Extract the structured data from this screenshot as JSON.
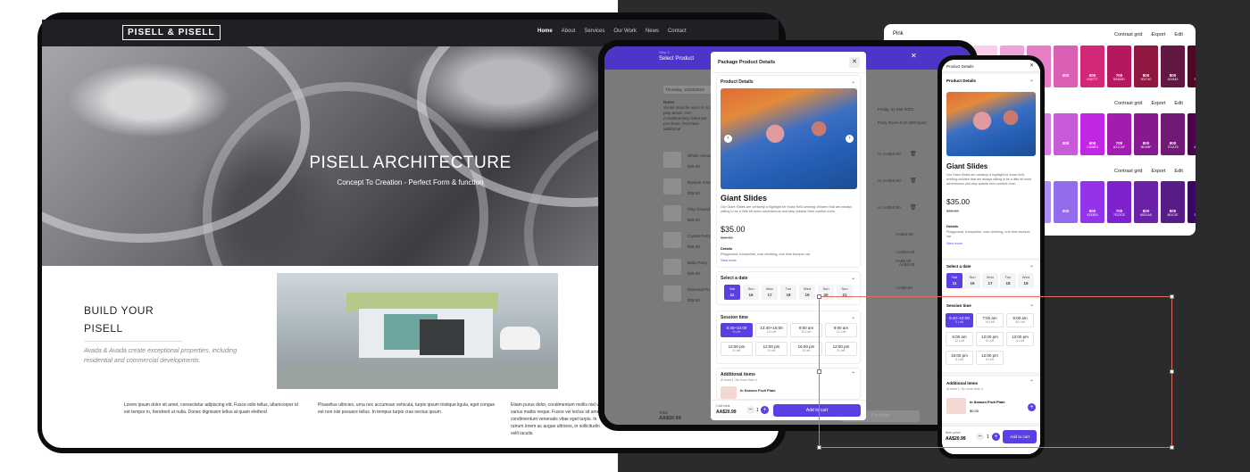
{
  "site": {
    "logo": "PISELL & PISELL",
    "nav": [
      "Home",
      "About",
      "Services",
      "Our Work",
      "News",
      "Contact"
    ],
    "hero_title": "PISELL ARCHITECTURE",
    "hero_subtitle": "Concept To Creation - Perfect Form & function",
    "build_line1": "BUILD YOUR",
    "build_line2": "PISELL",
    "build_desc": "Avada & Avada create exceptional properties, including residential and commercial developments.",
    "lorem1": "Lorem ipsum dolor sit amet, consectetur adipiscing elit. Fusce odio tellus, ullamcorper id est tempor in, hendrerit ut nulla. Donec dignissim tellus at quam eleifend",
    "lorem2": "Phasellus ultricies, urna nec accumsan vehicula, turpis ipsum tristique ligula, eget congue est non nisi posuere tellus. In tempus turpis cras nectus ipsum.",
    "lorem3": "Etiam purus dolor, condimentum mollis nisl vel, varius mattis neque. Fusce vel lectus sit amet leo condimentum venenatis vitae eget turpis. In rutrum lorem ac augue ultricies, in sollicitudin velit iaculis."
  },
  "tablet": {
    "step": "Step 2",
    "title": "Select Product",
    "date_left": "Thursday, 16/03/2023",
    "notes_label": "Notes",
    "notes_text": "Socks must be worn in ALL play areas. One complimentary ticket per purchase. Purchase additional",
    "date_right": "Friday, 31 Mar 2023",
    "room": "Party Room 8 (8-48People)",
    "list": [
      {
        "name": "Whole Venue",
        "price": "$35.00",
        "qty": "x1",
        "amount": "AA$10.00"
      },
      {
        "name": "Bumper Cars",
        "price": "$35.00",
        "qty": "x1",
        "amount": "AA$10.00"
      },
      {
        "name": "Play Ground",
        "price": "$35.00",
        "qty": "x1",
        "amount": "AA$10.00"
      },
      {
        "name": "Crystal Party",
        "price": "$35.00",
        "qty": "",
        "amount": "AA$22.99"
      },
      {
        "name": "Baby Party",
        "price": "$35.00",
        "qty": "",
        "amount": "AA$5.50"
      },
      {
        "name": "Diamond Pa",
        "price": "$35.00",
        "qty": "",
        "amount": "-AA$2.00"
      }
    ],
    "extra_amounts": [
      "-AA$10.00",
      "AA$2.00"
    ],
    "total_label": "Total",
    "total_value": "AA$20.99",
    "continue": "Continue"
  },
  "modal": {
    "title": "Package Product Details",
    "details_label": "Product Details",
    "product_name": "Giant Slides",
    "product_desc": "Our Giant Slides are certainly a highlight for those thrill-seeking children that are always willing to be a little bit more adventurous and step outside their comfort zone.",
    "price": "$35.00",
    "old_price": "$69.00",
    "details_heading": "Details",
    "details_text": "Playground, trampoline, rock climbing, one time bumper car",
    "view_more": "View more",
    "select_date": "Select a date",
    "dates": [
      {
        "day": "Sat",
        "num": "11",
        "selected": true
      },
      {
        "day": "Sun",
        "num": "16",
        "selected": false
      },
      {
        "day": "Mon",
        "num": "17",
        "selected": false
      },
      {
        "day": "Tue",
        "num": "18",
        "selected": false
      },
      {
        "day": "Wed",
        "num": "19",
        "selected": false
      },
      {
        "day": "Sun",
        "num": "20",
        "selected": false
      },
      {
        "day": "Sun",
        "num": "21",
        "selected": false
      }
    ],
    "session_label": "Session time",
    "sessions": [
      {
        "time": "9:40~10:00",
        "left": "5 Left",
        "selected": true
      },
      {
        "time": "13:40~16:00",
        "left": "14 Left",
        "selected": false
      },
      {
        "time": "9:00 am",
        "left": "50 Left",
        "selected": false
      },
      {
        "time": "9:00 am",
        "left": "12 Left",
        "selected": false
      },
      {
        "time": "12:00 pm",
        "left": "6 Left",
        "selected": false
      },
      {
        "time": "12:00 pm",
        "left": "9 Left",
        "selected": false
      },
      {
        "time": "16:00 pm",
        "left": "8 Left",
        "selected": false
      },
      {
        "time": "12:00 pm",
        "left": "6 Left",
        "selected": false
      }
    ],
    "additional_label": "Additional items",
    "additional_sub": "At least 1, No more than 4",
    "additional_item": "In Season Fruit Plate",
    "cart_total_label": "Cart total",
    "cart_total": "AA$20.99",
    "qty": "1",
    "add_to_cart": "Add to cart"
  },
  "palette": {
    "title": "Pink",
    "actions": [
      "Contrast grid",
      "Export",
      "Edit"
    ],
    "rows": [
      [
        {
          "label": "50",
          "hex": "",
          "color": "#f7cfe8"
        },
        {
          "label": "100",
          "hex": "",
          "color": "#f0a3d6"
        },
        {
          "label": "200",
          "hex": "",
          "color": "#e87dc7"
        },
        {
          "label": "300",
          "hex": "",
          "color": "#dc5fb6"
        },
        {
          "label": "600",
          "hex": "D32777",
          "color": "#d32777"
        },
        {
          "label": "700",
          "hex": "B5185D",
          "color": "#b5185d"
        },
        {
          "label": "800",
          "hex": "901740",
          "color": "#901740"
        },
        {
          "label": "800",
          "hex": "621843",
          "color": "#621843"
        },
        {
          "label": "900",
          "hex": "500724",
          "color": "#500724"
        }
      ],
      [
        {
          "label": "50",
          "hex": "",
          "color": "#efcdf3"
        },
        {
          "label": "100",
          "hex": "",
          "color": "#e3a7ec"
        },
        {
          "label": "200",
          "hex": "",
          "color": "#d57fe2"
        },
        {
          "label": "300",
          "hex": "",
          "color": "#c75bd8"
        },
        {
          "label": "600",
          "hex": "C026E3",
          "color": "#c026e3"
        },
        {
          "label": "700",
          "hex": "A21CAF",
          "color": "#a21caf"
        },
        {
          "label": "800",
          "hex": "86198F",
          "color": "#86198f"
        },
        {
          "label": "800",
          "hex": "701A75",
          "color": "#701a75"
        },
        {
          "label": "900",
          "hex": "4A044E",
          "color": "#4a044e"
        }
      ],
      [
        {
          "label": "50",
          "hex": "",
          "color": "#e1d3fb"
        },
        {
          "label": "100",
          "hex": "",
          "color": "#c9b2f7"
        },
        {
          "label": "200",
          "hex": "",
          "color": "#ae8ef2"
        },
        {
          "label": "300",
          "hex": "",
          "color": "#936ced"
        },
        {
          "label": "600",
          "hex": "9333EA",
          "color": "#9333ea"
        },
        {
          "label": "700",
          "hex": "7E22CE",
          "color": "#7e22ce"
        },
        {
          "label": "800",
          "hex": "6B21A8",
          "color": "#6b21a8"
        },
        {
          "label": "800",
          "hex": "581C87",
          "color": "#581c87"
        },
        {
          "label": "900",
          "hex": "3B0764",
          "color": "#3b0764"
        }
      ]
    ]
  },
  "phone": {
    "header": "Product Details",
    "details_label": "Product Details",
    "product_name": "Giant Slides",
    "product_desc": "Our Giant Slides are certainly a highlight for those thrill-seeking children that are always willing to be a little bit more adventurous and step outside their comfort zone.",
    "price": "$35.00",
    "old_price": "$69.00",
    "details_heading": "Details",
    "details_text": "Playground, trampoline, rock climbing, one time bumper car",
    "view_more": "View more",
    "select_date": "Select a date",
    "dates": [
      {
        "day": "Sat",
        "num": "11",
        "selected": true
      },
      {
        "day": "Sun",
        "num": "16",
        "selected": false
      },
      {
        "day": "Mon",
        "num": "17",
        "selected": false
      },
      {
        "day": "Tue",
        "num": "18",
        "selected": false
      },
      {
        "day": "Wed",
        "num": "19",
        "selected": false
      }
    ],
    "session_label": "Session time",
    "sessions": [
      {
        "time": "9:40~10:00",
        "left": "5 Left",
        "selected": true
      },
      {
        "time": "7:00 am",
        "left": "14 Left",
        "selected": false
      },
      {
        "time": "9:00 am",
        "left": "50 Left",
        "selected": false
      },
      {
        "time": "9:00 am",
        "left": "12 Left",
        "selected": false
      },
      {
        "time": "12:00 pm",
        "left": "6 Left",
        "selected": false
      },
      {
        "time": "12:00 pm",
        "left": "6 Left",
        "selected": false
      },
      {
        "time": "16:00 pm",
        "left": "8 Left",
        "selected": false
      },
      {
        "time": "12:00 pm",
        "left": "6 Left",
        "selected": false
      }
    ],
    "additional_label": "Additional items",
    "additional_sub": "At least 1, No more than 4",
    "additional_item": "In Season Fruit Plate",
    "additional_price": "$0.00",
    "item_price_label": "Item price",
    "item_price": "AA$20.99",
    "qty": "1",
    "add_to_cart": "Add to cart"
  }
}
